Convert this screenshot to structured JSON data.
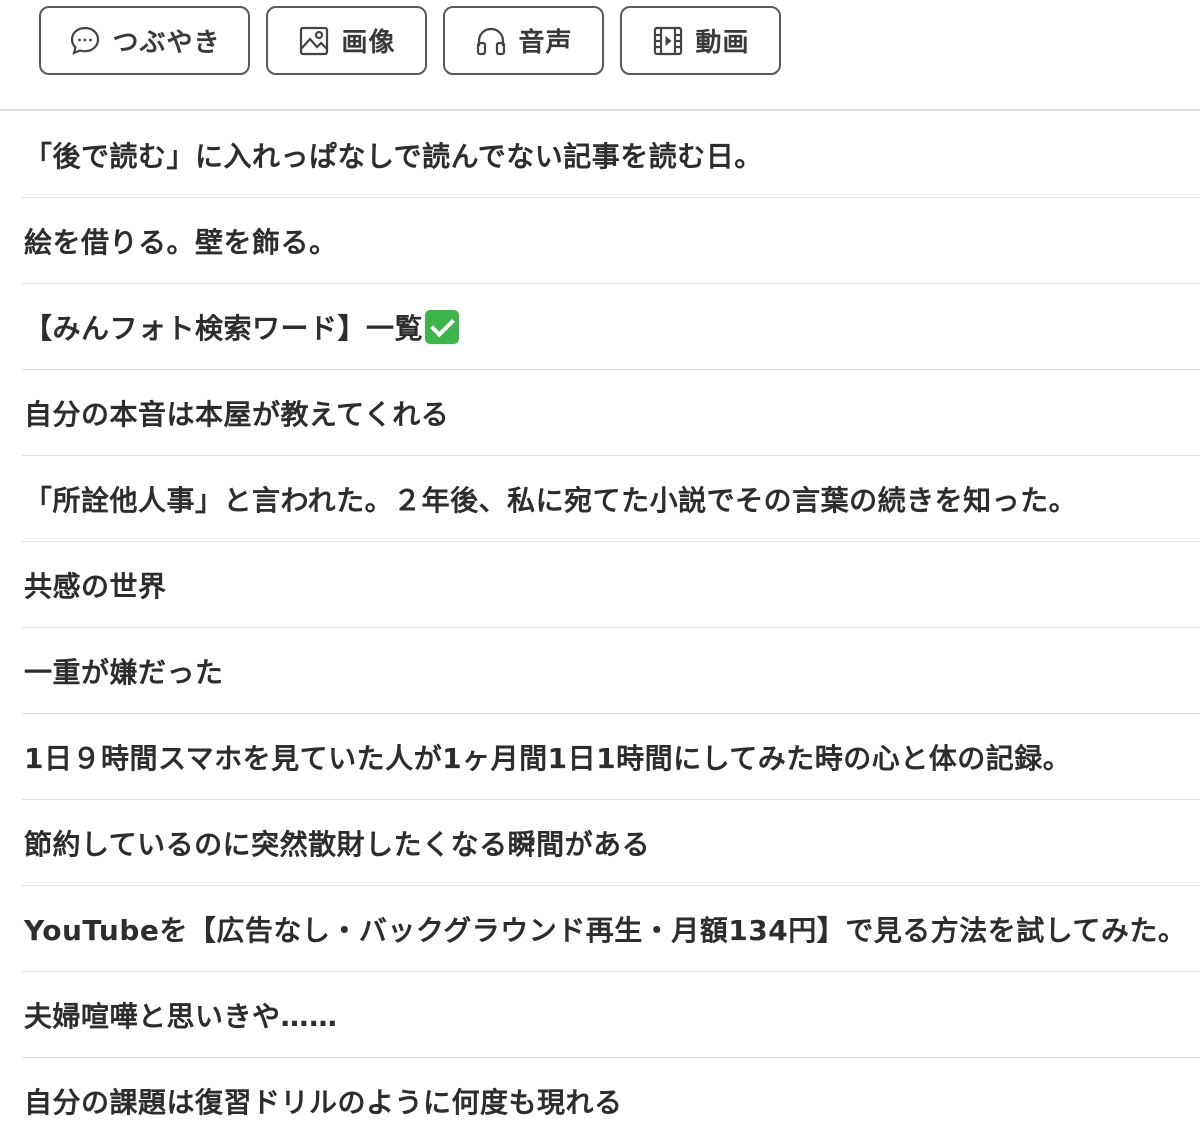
{
  "tabs": [
    {
      "label": "つぶやき",
      "icon": "chat-bubble-icon"
    },
    {
      "label": "画像",
      "icon": "image-icon"
    },
    {
      "label": "音声",
      "icon": "headphones-icon"
    },
    {
      "label": "動画",
      "icon": "film-icon"
    }
  ],
  "articles": [
    {
      "title": "「後で読む」に入れっぱなしで読んでない記事を読む日。"
    },
    {
      "title": "絵を借りる。壁を飾る。"
    },
    {
      "title": "【みんフォト検索ワード】一覧",
      "emoji": "check-mark-icon"
    },
    {
      "title": "自分の本音は本屋が教えてくれる"
    },
    {
      "title": "「所詮他人事」と言われた。２年後、私に宛てた小説でその言葉の続きを知った。"
    },
    {
      "title": "共感の世界"
    },
    {
      "title": "一重が嫌だった"
    },
    {
      "title": "1日９時間スマホを見ていた人が1ヶ月間1日1時間にしてみた時の心と体の記録。"
    },
    {
      "title": "節約しているのに突然散財したくなる瞬間がある"
    },
    {
      "title": "YouTubeを【広告なし・バックグラウンド再生・月額134円】で見る方法を試してみた。"
    },
    {
      "title": "夫婦喧嘩と思いきや……"
    },
    {
      "title": "自分の課題は復習ドリルのように何度も現れる"
    }
  ]
}
